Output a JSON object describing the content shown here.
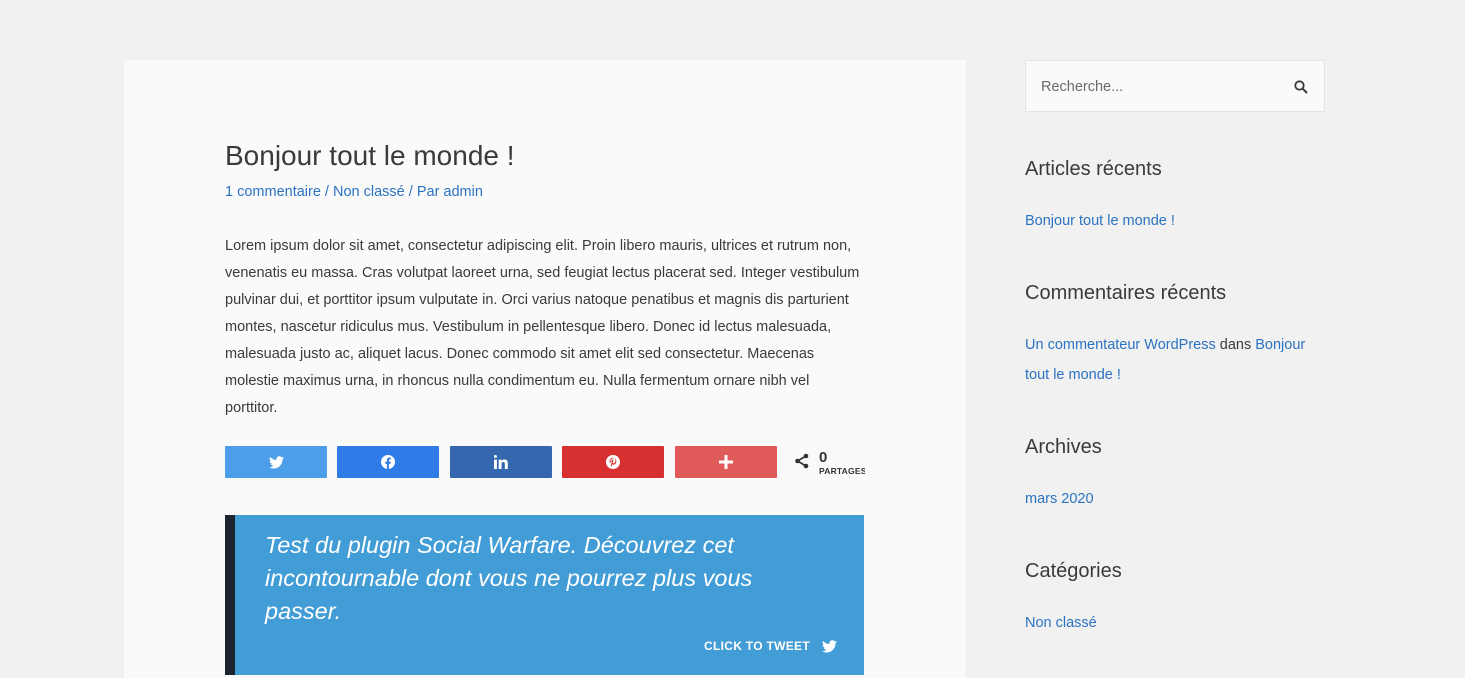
{
  "post": {
    "title": "Bonjour tout le monde !",
    "meta": {
      "comments": "1 commentaire",
      "separator": " / ",
      "category": "Non classé",
      "author": "Par admin"
    },
    "body": "Lorem ipsum dolor sit amet, consectetur adipiscing elit. Proin libero mauris, ultrices et rutrum non, venenatis eu massa. Cras volutpat laoreet urna, sed feugiat lectus placerat sed. Integer vestibulum pulvinar dui, et porttitor ipsum vulputate in. Orci varius natoque penatibus et magnis dis parturient montes, nascetur ridiculus mus. Vestibulum in pellentesque libero. Donec id lectus malesuada, malesuada justo ac, aliquet lacus. Donec commodo sit amet elit sed consectetur. Maecenas molestie maximus urna, in rhoncus nulla condimentum eu. Nulla fermentum ornare nibh vel porttitor."
  },
  "share": {
    "buttons": [
      {
        "network": "twitter",
        "icon": "twitter-icon",
        "color": "#429cd6"
      },
      {
        "network": "facebook",
        "icon": "facebook-icon",
        "color": "#0b80ff"
      },
      {
        "network": "linkedin",
        "icon": "linkedin-icon",
        "color": "#0d77b7"
      },
      {
        "network": "pinterest",
        "icon": "pinterest-icon",
        "color": "#cd2029"
      },
      {
        "network": "more",
        "icon": "plus-icon",
        "color": "#ee464f"
      }
    ],
    "total_count": "0",
    "total_label": "PARTAGES"
  },
  "click_to_tweet": {
    "quote": "Test du plugin Social Warfare. Découvrez cet incontournable dont vous ne pourrez plus vous passer.",
    "action_label": "CLICK TO TWEET",
    "background": "#429cd6",
    "bar_color": "#1c2430"
  },
  "sidebar": {
    "search_placeholder": "Recherche...",
    "recent_posts": {
      "title": "Articles récents",
      "items": [
        "Bonjour tout le monde !"
      ]
    },
    "recent_comments": {
      "title": "Commentaires récents",
      "author": "Un commentateur WordPress",
      "connector": "dans",
      "post": "Bonjour tout le monde !"
    },
    "archives": {
      "title": "Archives",
      "items": [
        "mars 2020"
      ]
    },
    "categories": {
      "title": "Catégories",
      "items": [
        "Non classé"
      ]
    }
  },
  "colors": {
    "link": "#2b73c2",
    "text": "#3a3a3a",
    "page_background": "#f1f1f1",
    "card_background": "#fafafa"
  }
}
